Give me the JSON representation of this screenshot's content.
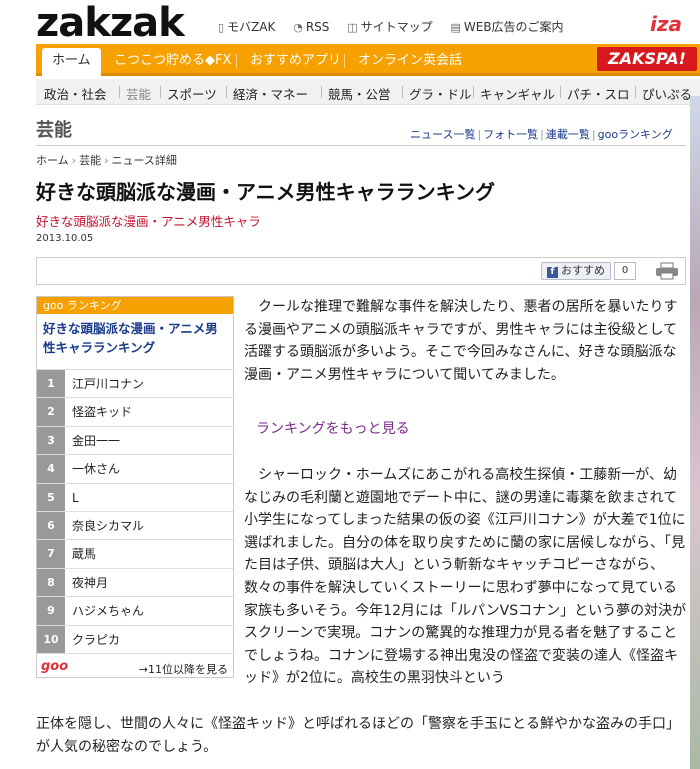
{
  "header": {
    "logo": "zakzak",
    "links": [
      {
        "label": "モバZAK"
      },
      {
        "label": "RSS"
      },
      {
        "label": "サイトマップ"
      },
      {
        "label": "WEB広告のご案内"
      }
    ],
    "partner_logo": "iza"
  },
  "nav": {
    "tabs": [
      {
        "label": "ホーム"
      },
      {
        "label": "こつこつ貯める◆FX"
      },
      {
        "label": "おすすめアプリ"
      },
      {
        "label": "オンライン英会話"
      }
    ],
    "spa_banner": "ZAKSPA!"
  },
  "subnav": {
    "items": [
      "政治・社会",
      "芸能",
      "スポーツ",
      "経済・マネー",
      "競馬・公営",
      "グラ・ドル",
      "キャンギャル",
      "パチ・スロ",
      "ぴいぷる"
    ]
  },
  "section": {
    "title": "芸能",
    "links": [
      "ニュース一覧",
      "フォト一覧",
      "連載一覧",
      "gooランキング"
    ]
  },
  "breadcrumb": [
    "ホーム",
    "芸能",
    "ニュース詳細"
  ],
  "article": {
    "headline": "好きな頭脳派な漫画・アニメ男性キャラランキング",
    "subhead": "好きな頭脳派な漫画・アニメ男性キャラ",
    "date": "2013.10.05",
    "share": {
      "fb_label": "おすすめ",
      "fb_count": "0"
    },
    "p1": "クールな推理で難解な事件を解決したり、悪者の居所を暴いたりする漫画やアニメの頭脳派キャラですが、男性キャラには主役級として活躍する頭脳派が多いよう。そこで今回みなさんに、好きな頭脳派な漫画・アニメ男性キャラについて聞いてみました。",
    "more_link": "ランキングをもっと見る",
    "p2": "シャーロック・ホームズにあこがれる高校生探偵・工藤新一が、幼なじみの毛利蘭と遊園地でデート中に、謎の男達に毒薬を飲まされて小学生になってしまった結果の仮の姿《江戸川コナン》が大差で1位に選ばれました。自分の体を取り戻すために蘭の家に居候しながら、「見た目は子供、頭脳は大人」という斬新なキャッチコピーさながら、数々の事件を解決していくストーリーに思わず夢中になって見ている家族も多いそう。今年12月には「ルパンVSコナン」という夢の対決がスクリーンで実現。コナンの驚異的な推理力が見る者を魅了することでしょうね。コナンに登場する神出鬼没の怪盗で変装の達人《怪盗キッド》が2位に。高校生の黒羽快斗という",
    "p3": "正体を隠し、世間の人々に《怪盗キッド》と呼ばれるほどの「警察を手玉にとる鮮やかな盗みの手口」が人気の秘密なのでしょう。"
  },
  "ranking": {
    "header": "goo ランキング",
    "title": "好きな頭脳派な漫画・アニメ男性キャラランキング",
    "items": [
      {
        "no": "1",
        "name": "江戸川コナン"
      },
      {
        "no": "2",
        "name": "怪盗キッド"
      },
      {
        "no": "3",
        "name": "金田一一"
      },
      {
        "no": "4",
        "name": "一休さん"
      },
      {
        "no": "5",
        "name": "L"
      },
      {
        "no": "6",
        "name": "奈良シカマル"
      },
      {
        "no": "7",
        "name": "蔵馬"
      },
      {
        "no": "8",
        "name": "夜神月"
      },
      {
        "no": "9",
        "name": "ハジメちゃん"
      },
      {
        "no": "10",
        "name": "クラピカ"
      }
    ],
    "footer_logo": "goo",
    "more": "→11位以降を見る"
  },
  "colors": {
    "accent": "#f6a100",
    "link": "#1a3a8a",
    "subhead": "#c8102e",
    "spa": "#d7191d"
  }
}
